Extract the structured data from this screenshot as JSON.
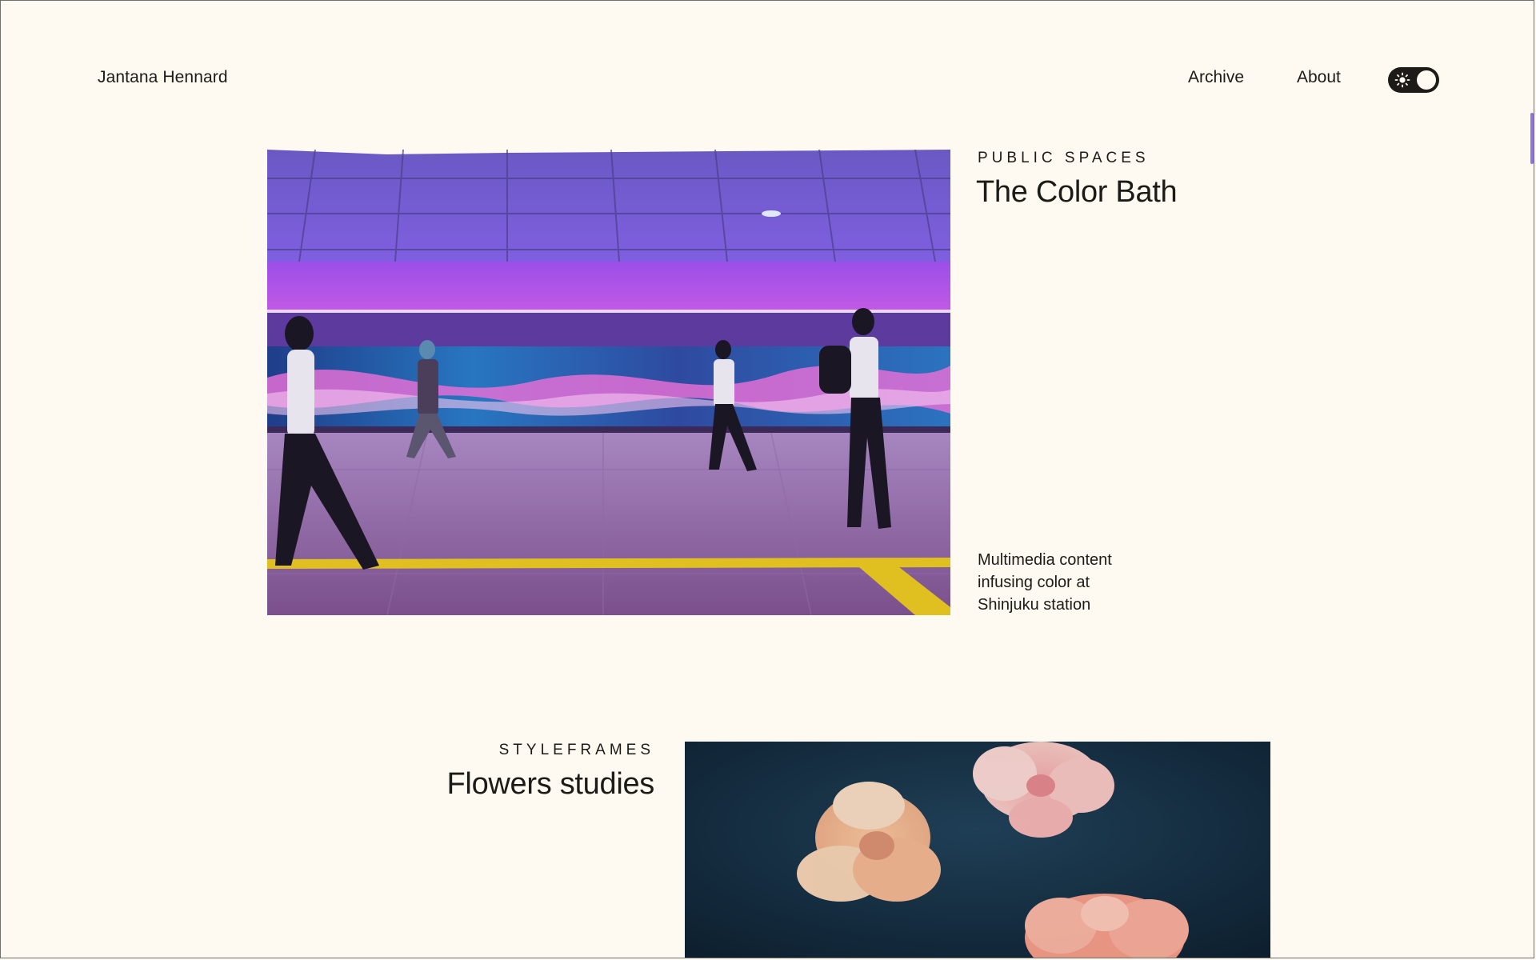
{
  "site": {
    "name": "Jantana Hennard"
  },
  "nav": {
    "items": [
      {
        "label": "Archive"
      },
      {
        "label": "About"
      }
    ],
    "theme_toggle_icon": "sun-icon"
  },
  "projects": [
    {
      "category": "PUBLIC SPACES",
      "title": "The Color Bath",
      "description": "Multimedia content infusing color at Shinjuku station"
    },
    {
      "category": "STYLEFRAMES",
      "title": "Flowers studies"
    }
  ],
  "colors": {
    "background": "#fefaf1",
    "text": "#1d1b18",
    "accent": "#8a76d8"
  }
}
